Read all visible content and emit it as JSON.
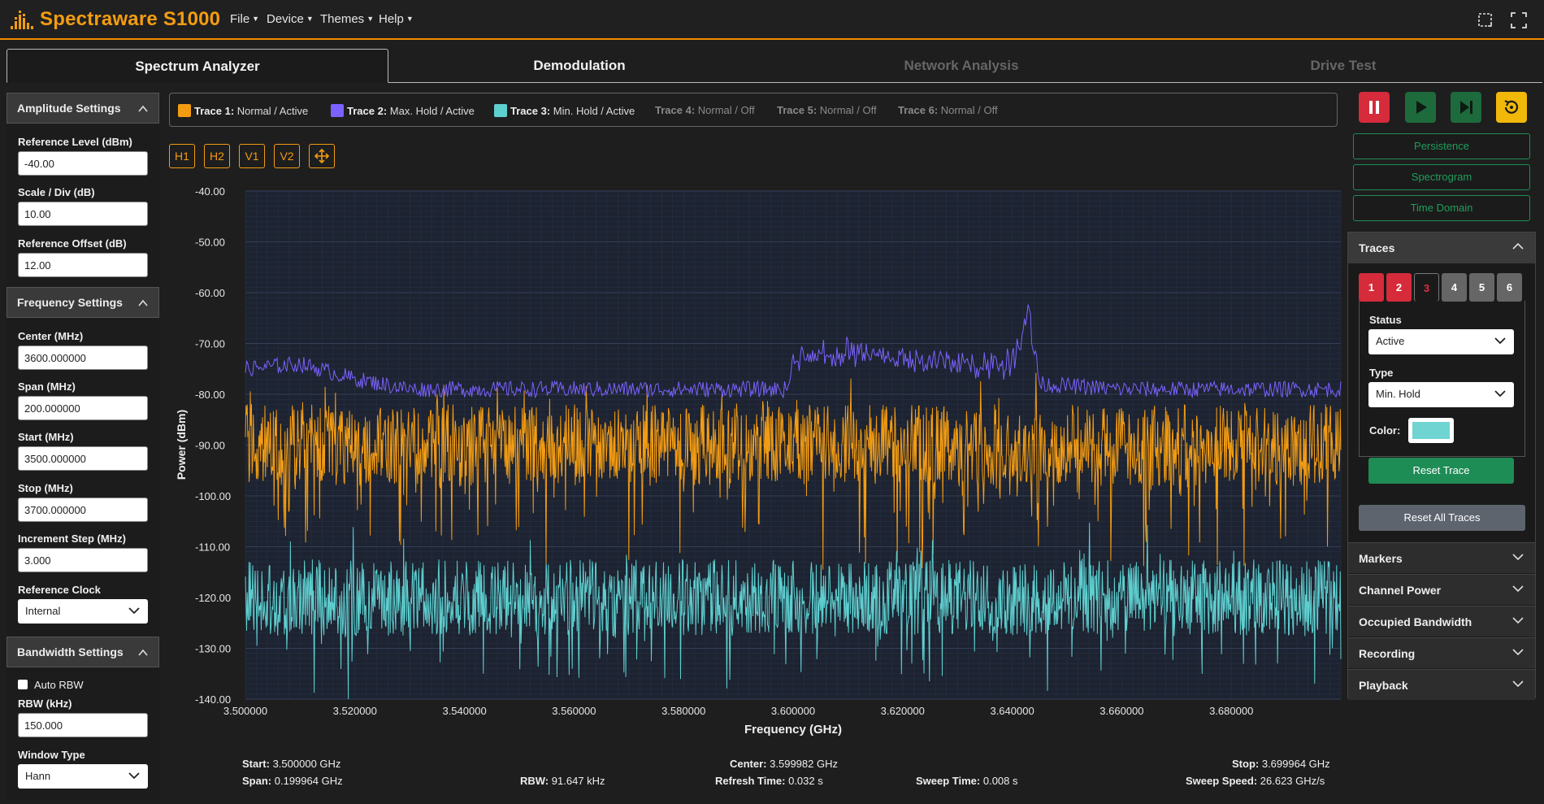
{
  "app": {
    "title": "Spectraware S1000",
    "menus": [
      "File",
      "Device",
      "Themes",
      "Help"
    ],
    "accent": "#f39c12"
  },
  "tabs": [
    {
      "label": "Spectrum Analyzer",
      "active": true
    },
    {
      "label": "Demodulation",
      "active": false
    },
    {
      "label": "Network Analysis",
      "active": false
    },
    {
      "label": "Drive Test",
      "active": false
    }
  ],
  "amplitude": {
    "title": "Amplitude Settings",
    "ref_level_label": "Reference Level (dBm)",
    "ref_level": "-40.00",
    "scale_label": "Scale / Div (dB)",
    "scale": "10.00",
    "offset_label": "Reference Offset (dB)",
    "offset": "12.00"
  },
  "frequency": {
    "title": "Frequency Settings",
    "center_label": "Center (MHz)",
    "center": "3600.000000",
    "span_label": "Span (MHz)",
    "span": "200.000000",
    "start_label": "Start (MHz)",
    "start": "3500.000000",
    "stop_label": "Stop (MHz)",
    "stop": "3700.000000",
    "step_label": "Increment Step (MHz)",
    "step": "3.000",
    "clock_label": "Reference Clock",
    "clock": "Internal"
  },
  "bandwidth": {
    "title": "Bandwidth Settings",
    "auto_rbw_label": "Auto RBW",
    "rbw_label": "RBW (kHz)",
    "rbw": "150.000",
    "window_label": "Window Type",
    "window": "Hann"
  },
  "legend": [
    {
      "name": "Trace 1:",
      "desc": "Normal / Active",
      "color": "#f39c12",
      "on": true
    },
    {
      "name": "Trace 2:",
      "desc": "Max. Hold / Active",
      "color": "#7b61ff",
      "on": true
    },
    {
      "name": "Trace 3:",
      "desc": "Min. Hold / Active",
      "color": "#5ecfcf",
      "on": true
    },
    {
      "name": "Trace 4:",
      "desc": "Normal / Off",
      "color": "",
      "on": false
    },
    {
      "name": "Trace 5:",
      "desc": "Normal / Off",
      "color": "",
      "on": false
    },
    {
      "name": "Trace 6:",
      "desc": "Normal / Off",
      "color": "",
      "on": false
    }
  ],
  "marker_buttons": [
    "H1",
    "H2",
    "V1",
    "V2"
  ],
  "chart_data": {
    "type": "line",
    "xlabel": "Frequency (GHz)",
    "ylabel": "Power (dBm)",
    "xlim": [
      3.5,
      3.7
    ],
    "ylim": [
      -140,
      -40
    ],
    "x_ticks": [
      "3.500000",
      "3.520000",
      "3.540000",
      "3.560000",
      "3.580000",
      "3.600000",
      "3.620000",
      "3.640000",
      "3.660000",
      "3.680000"
    ],
    "y_ticks": [
      "-40.00",
      "-50.00",
      "-60.00",
      "-70.00",
      "-80.00",
      "-90.00",
      "-100.00",
      "-110.00",
      "-120.00",
      "-130.00",
      "-140.00"
    ],
    "grid": true,
    "series": [
      {
        "name": "Trace 1",
        "color": "#f39c12",
        "x": [
          3.5,
          3.52,
          3.54,
          3.56,
          3.58,
          3.6,
          3.62,
          3.64,
          3.66,
          3.68,
          3.7
        ],
        "values": [
          -90,
          -90,
          -90,
          -90,
          -90,
          -89,
          -90,
          -90,
          -90,
          -90,
          -90
        ]
      },
      {
        "name": "Trace 2",
        "color": "#7b61ff",
        "x": [
          3.5,
          3.51,
          3.52,
          3.53,
          3.54,
          3.56,
          3.58,
          3.599,
          3.6,
          3.61,
          3.62,
          3.63,
          3.64,
          3.643,
          3.645,
          3.66,
          3.68,
          3.7
        ],
        "values": [
          -75,
          -74,
          -77,
          -79,
          -79,
          -79,
          -79,
          -79,
          -73,
          -72,
          -73,
          -74,
          -74,
          -63,
          -78,
          -79,
          -79,
          -79
        ]
      },
      {
        "name": "Trace 3",
        "color": "#5ecfcf",
        "x": [
          3.5,
          3.52,
          3.54,
          3.56,
          3.58,
          3.6,
          3.62,
          3.64,
          3.66,
          3.68,
          3.7
        ],
        "values": [
          -120,
          -120,
          -120,
          -120,
          -120,
          -120,
          -120,
          -120,
          -120,
          -120,
          -120
        ]
      }
    ]
  },
  "footer": {
    "start_label": "Start:",
    "start": "3.500000 GHz",
    "span_label": "Span:",
    "span": "0.199964 GHz",
    "rbw_label": "RBW:",
    "rbw": "91.647 kHz",
    "center_label": "Center:",
    "center": "3.599982 GHz",
    "refresh_label": "Refresh Time:",
    "refresh": "0.032 s",
    "sweep_label": "Sweep Time:",
    "sweep": "0.008 s",
    "stop_label": "Stop:",
    "stop": "3.699964 GHz",
    "speed_label": "Sweep Speed:",
    "speed": "26.623 GHz/s"
  },
  "view_buttons": [
    "Persistence",
    "Spectrogram",
    "Time Domain"
  ],
  "traces_panel": {
    "title": "Traces",
    "trace_tabs": [
      "1",
      "2",
      "3",
      "4",
      "5",
      "6"
    ],
    "selected": "3",
    "status_label": "Status",
    "status": "Active",
    "type_label": "Type",
    "type": "Min. Hold",
    "color_label": "Color:",
    "color": "#6fd4d2",
    "reset_trace": "Reset Trace",
    "reset_all": "Reset All Traces"
  },
  "collapsed_sections": [
    "Markers",
    "Channel Power",
    "Occupied Bandwidth",
    "Recording",
    "Playback"
  ]
}
